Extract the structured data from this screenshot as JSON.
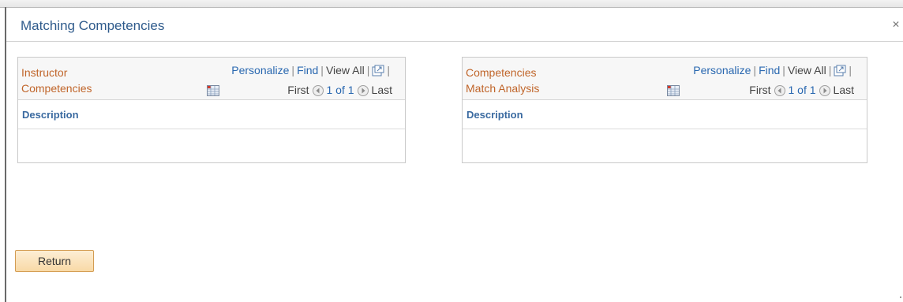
{
  "dialog": {
    "title": "Matching Competencies",
    "close_icon": "close-icon"
  },
  "grids": [
    {
      "title": "Instructor Competencies",
      "personalize": "Personalize",
      "find": "Find",
      "view_all": "View All",
      "first": "First",
      "page": "1 of 1",
      "last": "Last",
      "column": "Description"
    },
    {
      "title": "Competencies Match Analysis",
      "personalize": "Personalize",
      "find": "Find",
      "view_all": "View All",
      "first": "First",
      "page": "1 of 1",
      "last": "Last",
      "column": "Description"
    }
  ],
  "buttons": {
    "return": "Return"
  },
  "colors": {
    "accent_link": "#2a68b0",
    "grid_title": "#c0652a",
    "button_bg": "#f8d9a6"
  }
}
